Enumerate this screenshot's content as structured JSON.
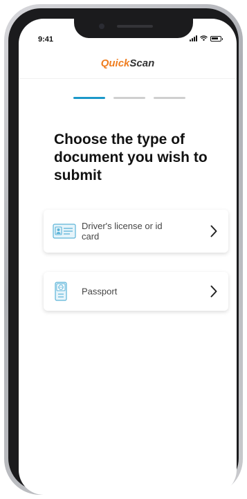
{
  "status_bar": {
    "time": "9:41"
  },
  "app": {
    "logo_part1": "Quick",
    "logo_part2": "Scan",
    "brand_color": "#ef7d1f",
    "accent_color": "#1b98c9"
  },
  "stepper": {
    "current_step": 1,
    "total_steps": 3
  },
  "title": "Choose the type of document you wish to submit",
  "options": [
    {
      "label": "Driver's license or id card",
      "icon": "id-card-icon"
    },
    {
      "label": "Passport",
      "icon": "passport-icon"
    }
  ]
}
